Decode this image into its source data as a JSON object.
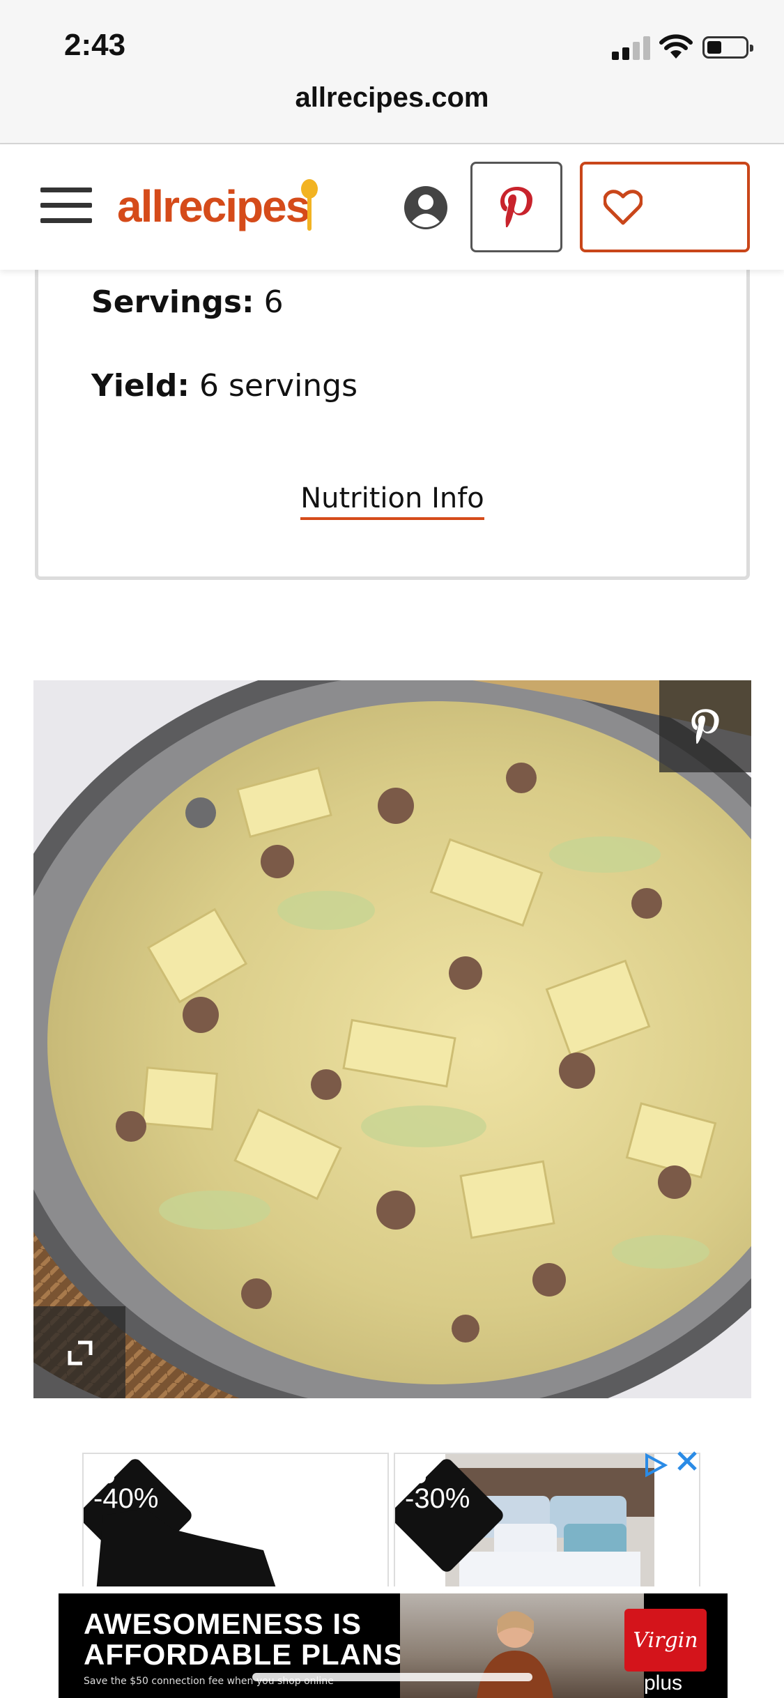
{
  "status_bar": {
    "time": "2:43",
    "url": "allrecipes.com"
  },
  "header": {
    "logo_text": "allrecipes",
    "brand_color": "#d54b1a",
    "menu_icon": "hamburger-menu-icon",
    "account_icon": "user-circle-icon",
    "pinterest_icon": "pinterest-icon",
    "favorite_icon": "heart-icon"
  },
  "recipe_info": {
    "servings_label": "Servings:",
    "servings_value": "6",
    "yield_label": "Yield:",
    "yield_value": "6 servings",
    "nutrition_link": "Nutrition Info"
  },
  "photo": {
    "pin_icon": "pinterest-icon",
    "expand_icon": "expand-icon"
  },
  "ads": {
    "product_1_discount": "-40%",
    "product_2_discount": "-30%",
    "adchoices_icon": "adchoices-icon",
    "close_icon": "close-icon",
    "banner_line_1": "AWESOMENESS IS",
    "banner_line_2": "AFFORDABLE PLANS.",
    "banner_fine_print": "Save the $50 connection fee when you shop online",
    "banner_brand": "Virgin",
    "banner_brand_suffix": "plus"
  }
}
